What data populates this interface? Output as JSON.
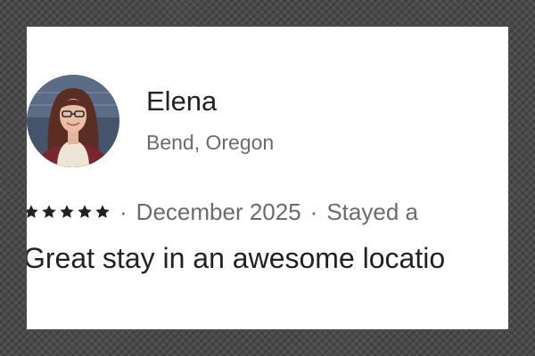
{
  "reviewer": {
    "name": "Elena",
    "location": "Bend, Oregon"
  },
  "review": {
    "rating": 5,
    "date": "December 2025",
    "stay_info": "Stayed a",
    "text": "Great stay in an awesome locatio",
    "separator": "·"
  },
  "colors": {
    "star": "#222222",
    "name": "#222222",
    "secondary_text": "#6b6b6b",
    "card_background": "#ffffff"
  },
  "icons": {
    "star": "star-icon",
    "avatar": "avatar"
  }
}
